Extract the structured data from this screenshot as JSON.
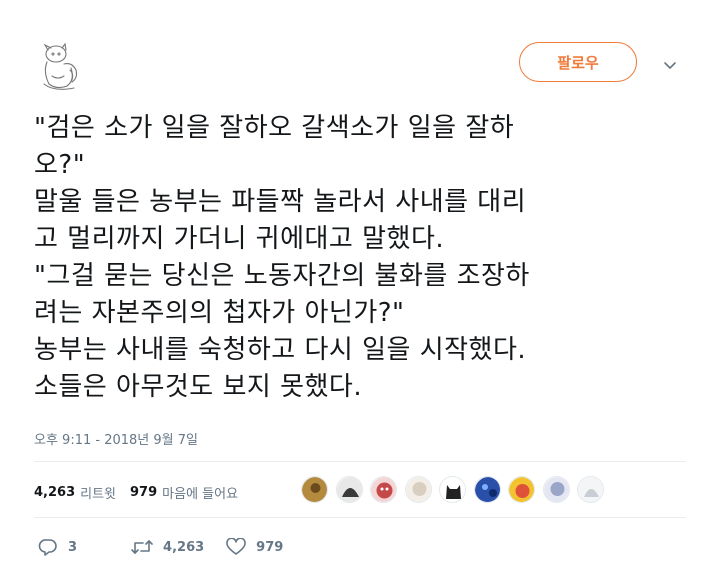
{
  "header": {
    "follow_label": "팔로우"
  },
  "tweet": {
    "lines": [
      "\"검은 소가 일을 잘하오 갈색소가 일을 잘하",
      "오?\"",
      "말울 들은 농부는 파들짝 놀라서 사내를 대리",
      "고 멀리까지 가더니 귀에대고 말했다.",
      "\"그걸 묻는 당신은 노동자간의 불화를 조장하",
      "려는 자본주의의 첩자가 아닌가?\"",
      "농부는 사내를 숙청하고 다시 일을 시작했다.",
      "소들은 아무것도 보지 못했다."
    ],
    "timestamp": "오후 9:11 - 2018년 9월 7일"
  },
  "stats": {
    "retweet_count": "4,263",
    "retweet_label": "리트윗",
    "like_count": "979",
    "like_label": "마음에 들어요"
  },
  "likers": [
    {
      "color": "#b38a3e"
    },
    {
      "color": "#3a3a3a"
    },
    {
      "color": "#c44a4a"
    },
    {
      "color": "#d8cfc0"
    },
    {
      "color": "#222222"
    },
    {
      "color": "#2a4fa8"
    },
    {
      "color": "#f2c230"
    },
    {
      "color": "#9aa6c8"
    },
    {
      "color": "#c9ced6"
    }
  ],
  "actions": {
    "reply_count": "3",
    "retweet_count": "4,263",
    "like_count": "979"
  },
  "colors": {
    "accent": "#f07b3a",
    "muted": "#657786"
  },
  "icons": [
    "user-avatar",
    "chevron-down-icon",
    "reply-icon",
    "retweet-icon",
    "heart-icon"
  ]
}
